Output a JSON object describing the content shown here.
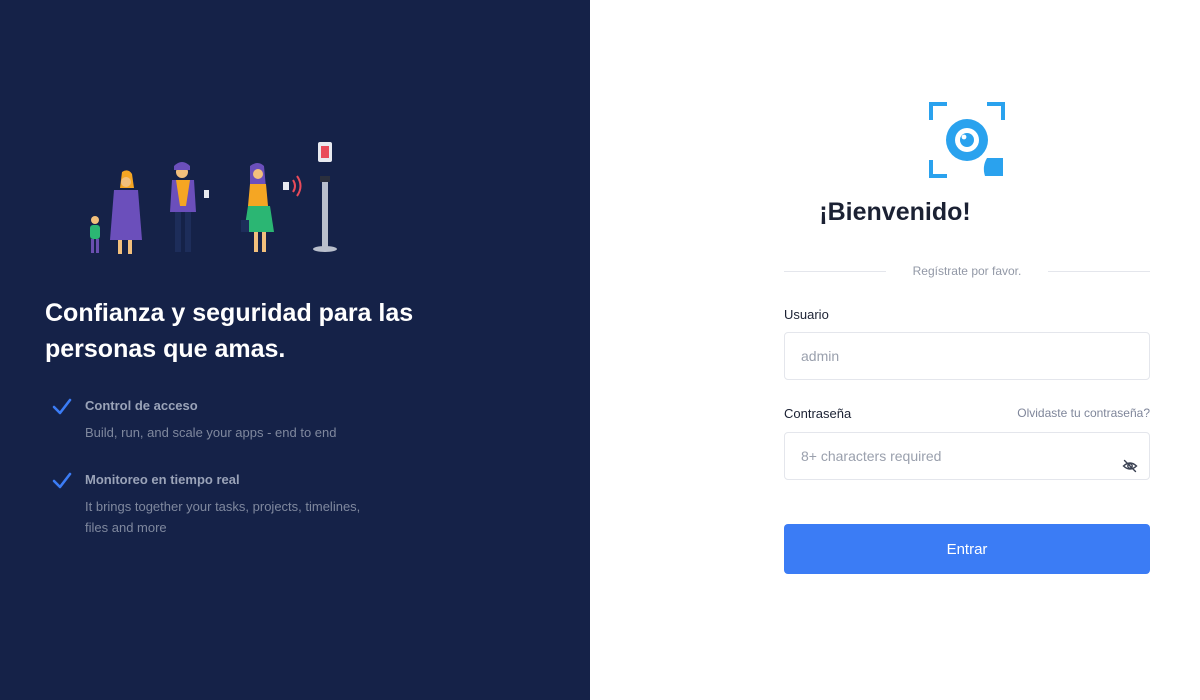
{
  "brand": {
    "accent_color": "#3b7cf5",
    "left_panel_color": "#152248",
    "logo_color": "#2aa2ee"
  },
  "left": {
    "headline": "Confianza y seguridad para las personas que amas.",
    "features": [
      {
        "icon": "check-icon",
        "title": "Control de acceso",
        "description": "Build, run, and scale your apps - end to end"
      },
      {
        "icon": "check-icon",
        "title": "Monitoreo en tiempo real",
        "description": "It brings together your tasks, projects, timelines, files and more"
      }
    ]
  },
  "login": {
    "title": "¡Bienvenido!",
    "subtitle": "Regístrate por favor.",
    "username_label": "Usuario",
    "username_placeholder": "admin",
    "password_label": "Contraseña",
    "password_placeholder": "8+ characters required",
    "forgot_password": "Olvidaste tu contraseña?",
    "submit_label": "Entrar"
  }
}
